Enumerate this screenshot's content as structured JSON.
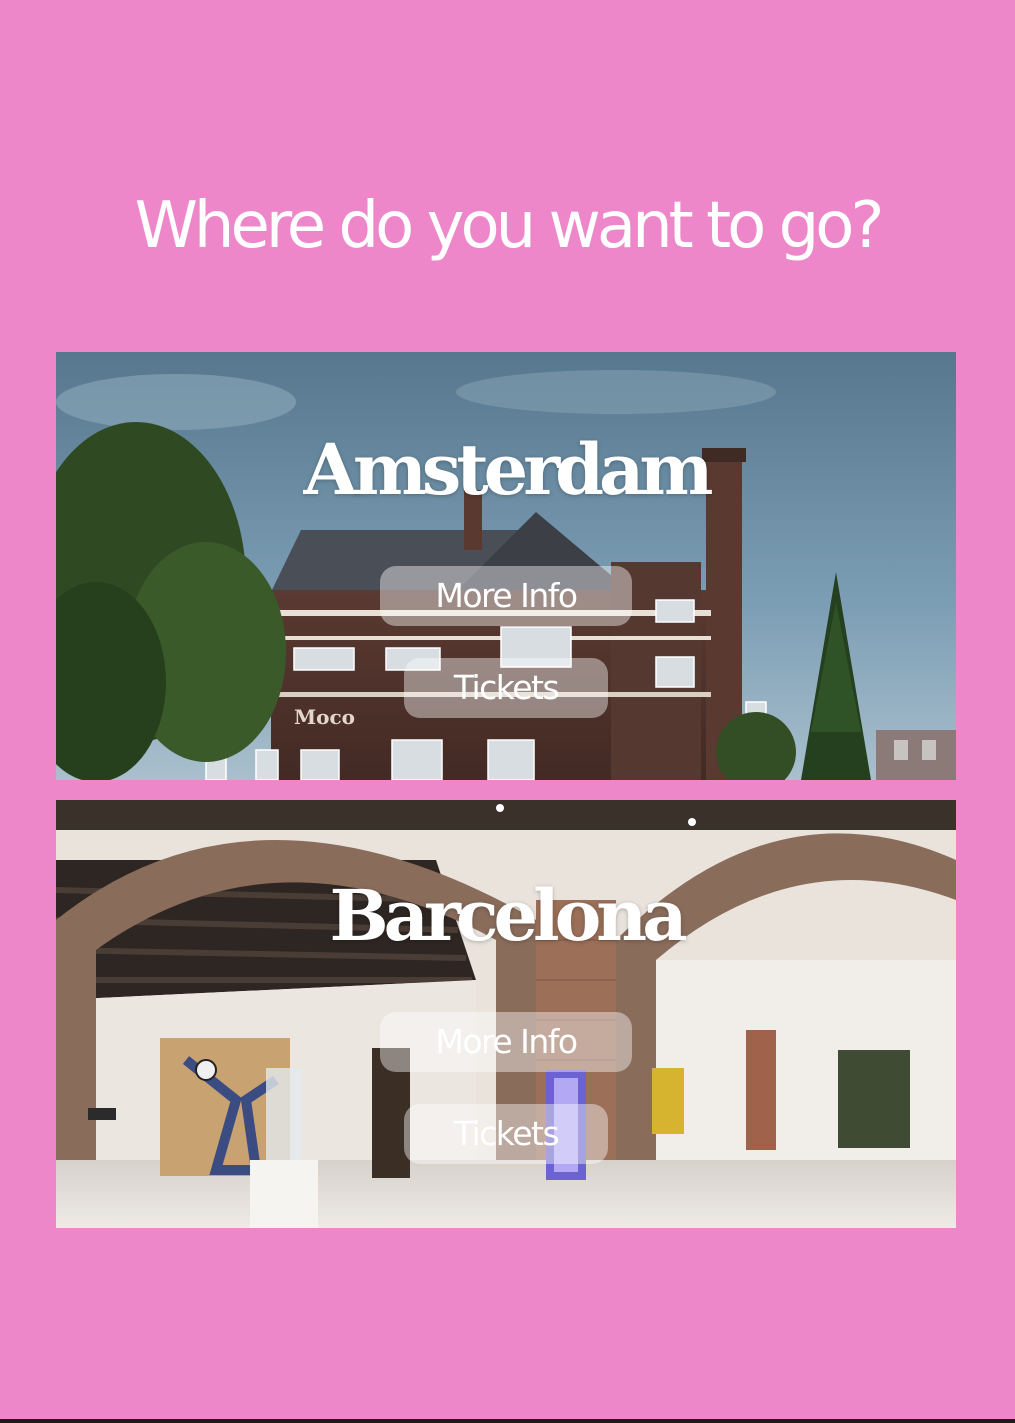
{
  "page": {
    "title": "Where do you want to go?",
    "background_color": "#ee87c9"
  },
  "destinations": [
    {
      "city": "Amsterdam",
      "more_info_label": "More Info",
      "tickets_label": "Tickets",
      "building_sign": "Moco"
    },
    {
      "city": "Barcelona",
      "more_info_label": "More Info",
      "tickets_label": "Tickets"
    }
  ]
}
